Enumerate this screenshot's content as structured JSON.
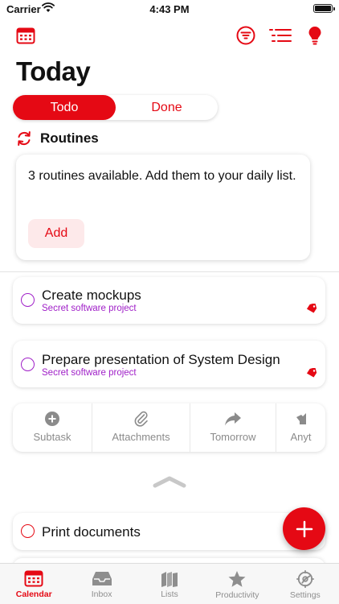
{
  "status_bar": {
    "carrier": "Carrier",
    "time": "4:43 PM",
    "battery_level": 1.0
  },
  "header": {
    "icons": [
      "calendar-icon",
      "filter-icon",
      "list-icon",
      "bulb-icon"
    ],
    "title": "Today"
  },
  "segments": {
    "todo": "Todo",
    "done": "Done",
    "selected": "Todo"
  },
  "routines": {
    "title": "Routines",
    "message": "3 routines available. Add them to your daily list.",
    "add_label": "Add"
  },
  "tasks": [
    {
      "title": "Create mockups",
      "project": "Secret software project"
    },
    {
      "title": "Prepare presentation of System Design",
      "project": "Secret software project"
    }
  ],
  "actions": [
    {
      "label": "Subtask",
      "icon": "plus-circle-icon"
    },
    {
      "label": "Attachments",
      "icon": "paperclip-icon"
    },
    {
      "label": "Tomorrow",
      "icon": "forward-arrow-icon"
    },
    {
      "label": "Anyt",
      "icon": "anytime-icon"
    }
  ],
  "print_task": {
    "title": "Print documents"
  },
  "tabs": [
    {
      "label": "Calendar",
      "icon": "calendar-icon",
      "active": true
    },
    {
      "label": "Inbox",
      "icon": "inbox-icon",
      "active": false
    },
    {
      "label": "Lists",
      "icon": "lists-icon",
      "active": false
    },
    {
      "label": "Productivity",
      "icon": "star-icon",
      "active": false
    },
    {
      "label": "Settings",
      "icon": "gear-icon",
      "active": false
    }
  ],
  "colors": {
    "accent": "#e50914",
    "project": "#a020c8",
    "muted": "#8e8e8e"
  }
}
